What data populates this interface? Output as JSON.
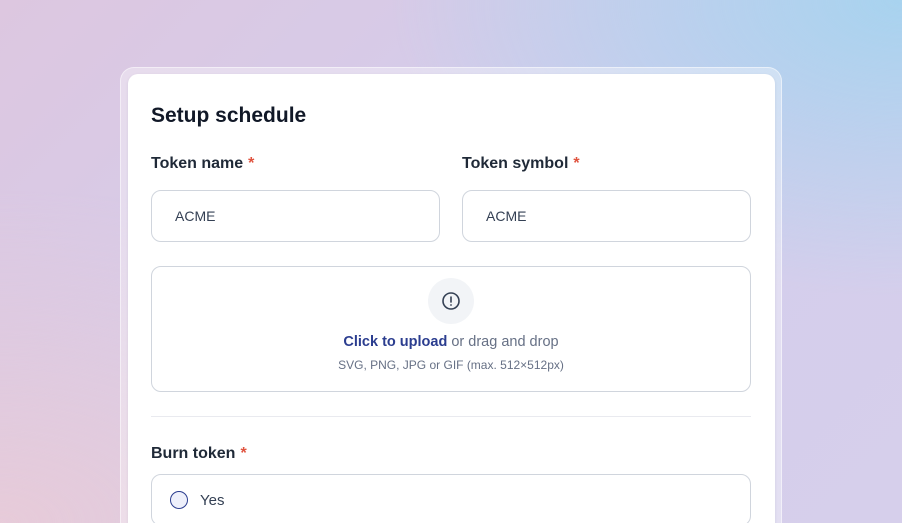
{
  "form": {
    "title": "Setup schedule",
    "token_name": {
      "label": "Token name",
      "required_mark": "*",
      "value": "ACME"
    },
    "token_symbol": {
      "label": "Token symbol",
      "required_mark": "*",
      "value": "ACME"
    },
    "upload": {
      "icon": "alert-circle-icon",
      "link_text": "Click to upload",
      "rest_text": "or drag and drop",
      "hint": "SVG, PNG, JPG or GIF (max. 512×512px)"
    },
    "burn_token": {
      "label": "Burn token",
      "required_mark": "*",
      "options": [
        {
          "label": "Yes",
          "selected": false
        }
      ]
    }
  },
  "colors": {
    "accent": "#2b3d8f",
    "required": "#e0533f",
    "border": "#d0d5dd"
  }
}
